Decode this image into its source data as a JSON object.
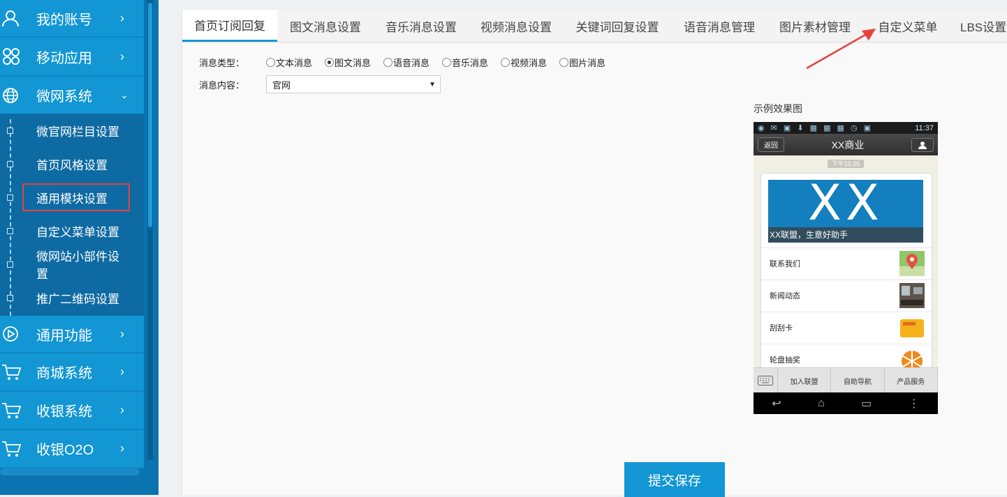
{
  "sidebar": {
    "items": [
      {
        "label": "我的账号",
        "icon": "user-icon"
      },
      {
        "label": "移动应用",
        "icon": "flower-icon"
      },
      {
        "label": "微网系统",
        "icon": "globe-icon"
      },
      {
        "label": "通用功能",
        "icon": "play-icon"
      },
      {
        "label": "商城系统",
        "icon": "cart-icon"
      },
      {
        "label": "收银系统",
        "icon": "cart-icon"
      },
      {
        "label": "收银O2O",
        "icon": "cart-icon"
      }
    ],
    "subitems": [
      {
        "label": "微官网栏目设置"
      },
      {
        "label": "首页风格设置"
      },
      {
        "label": "通用模块设置"
      },
      {
        "label": "自定义菜单设置"
      },
      {
        "label": "微网站小部件设置"
      },
      {
        "label": "推广二维码设置"
      }
    ]
  },
  "tabs": [
    {
      "label": "首页订阅回复"
    },
    {
      "label": "图文消息设置"
    },
    {
      "label": "音乐消息设置"
    },
    {
      "label": "视频消息设置"
    },
    {
      "label": "关键词回复设置"
    },
    {
      "label": "语音消息管理"
    },
    {
      "label": "图片素材管理"
    },
    {
      "label": "自定义菜单"
    },
    {
      "label": "LBS设置"
    }
  ],
  "form": {
    "type_label": "消息类型：",
    "types": [
      {
        "label": "文本消息",
        "checked": false
      },
      {
        "label": "图文消息",
        "checked": true
      },
      {
        "label": "语音消息",
        "checked": false
      },
      {
        "label": "音乐消息",
        "checked": false
      },
      {
        "label": "视频消息",
        "checked": false
      },
      {
        "label": "图片消息",
        "checked": false
      }
    ],
    "content_label": "消息内容：",
    "content_value": "官网",
    "submit_label": "提交保存"
  },
  "preview": {
    "title": "示例效果图",
    "status_time": "11:37",
    "back_label": "返回",
    "app_title": "XX商业",
    "msg_time": "下午15:25",
    "banner_text": "XX",
    "banner_caption": "XX联盟，生意好助手",
    "list": [
      {
        "label": "联系我们"
      },
      {
        "label": "新闻动态"
      },
      {
        "label": "刮刮卡"
      },
      {
        "label": "轮盘抽奖"
      }
    ],
    "menu": [
      {
        "label": "加入联盟"
      },
      {
        "label": "自助导航"
      },
      {
        "label": "产品服务"
      }
    ]
  },
  "colors": {
    "sidebar_bg": "#1296d4",
    "sidebar_sub_bg": "#0e6aa2",
    "accent": "#1296d4",
    "highlight": "#e8413c"
  }
}
